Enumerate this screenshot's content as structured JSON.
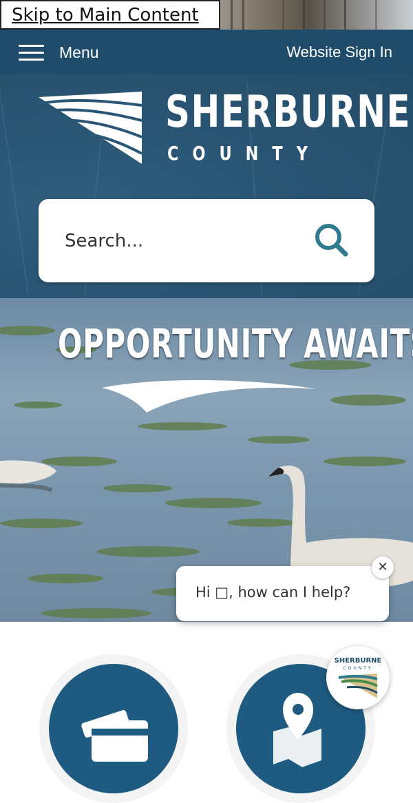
{
  "skip_link": {
    "label": "Skip to Main Content"
  },
  "nav": {
    "menu_label": "Menu",
    "signin_label": "Website Sign In"
  },
  "brand": {
    "name": "SHERBURNE",
    "subtitle": "COUNTY"
  },
  "search": {
    "placeholder": "Search..."
  },
  "hero": {
    "tagline": "OPPORTUNITY AWAITS"
  },
  "chat": {
    "message": "Hi □, how can I help?",
    "close_label": "✕"
  },
  "colors": {
    "nav": "#1f4c6b",
    "header": "#2a5675",
    "tile": "#1f5a80",
    "search_icon": "#2f7a8c"
  },
  "icons": [
    "menu-icon",
    "search-icon",
    "close-icon",
    "payment-card-icon",
    "map-pin-icon"
  ]
}
